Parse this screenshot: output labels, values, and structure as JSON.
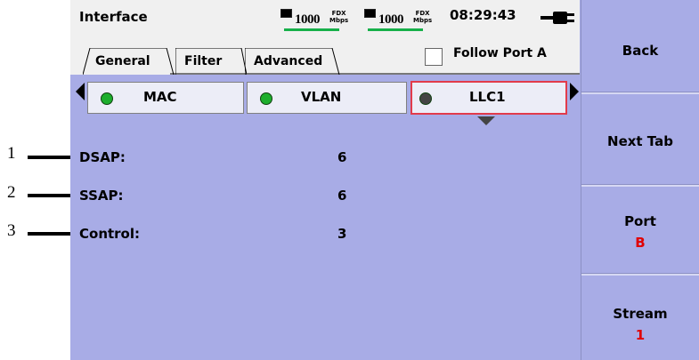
{
  "title_bar": {
    "title": "Interface",
    "ports": [
      {
        "speed": "1000",
        "duplex": "FDX",
        "unit": "Mbps"
      },
      {
        "speed": "1000",
        "duplex": "FDX",
        "unit": "Mbps"
      }
    ],
    "time": "08:29:43",
    "icons": [
      "port-led-icon",
      "power-plug-icon"
    ]
  },
  "tabs": [
    {
      "label": "General",
      "active": true
    },
    {
      "label": "Filter",
      "active": false
    },
    {
      "label": "Advanced",
      "active": false
    }
  ],
  "follow_port": {
    "label": "Follow Port A",
    "checked": false
  },
  "subtabs": [
    {
      "label": "MAC",
      "status": "green"
    },
    {
      "label": "VLAN",
      "status": "green"
    },
    {
      "label": "LLC1",
      "status": "dark",
      "selected": true
    }
  ],
  "fields": [
    {
      "label": "DSAP:",
      "value": "6"
    },
    {
      "label": "SSAP:",
      "value": "6"
    },
    {
      "label": "Control:",
      "value": "3"
    }
  ],
  "side_buttons": [
    {
      "label": "Back",
      "value": ""
    },
    {
      "label": "Next Tab",
      "value": ""
    },
    {
      "label": "Port",
      "value": "B"
    },
    {
      "label": "Stream",
      "value": "1"
    }
  ],
  "callouts": [
    "1",
    "2",
    "3"
  ],
  "colors": {
    "background": "#a8ace6",
    "accent": "#e00000",
    "selection": "#e23b4b",
    "link_ok": "#17b04a"
  }
}
